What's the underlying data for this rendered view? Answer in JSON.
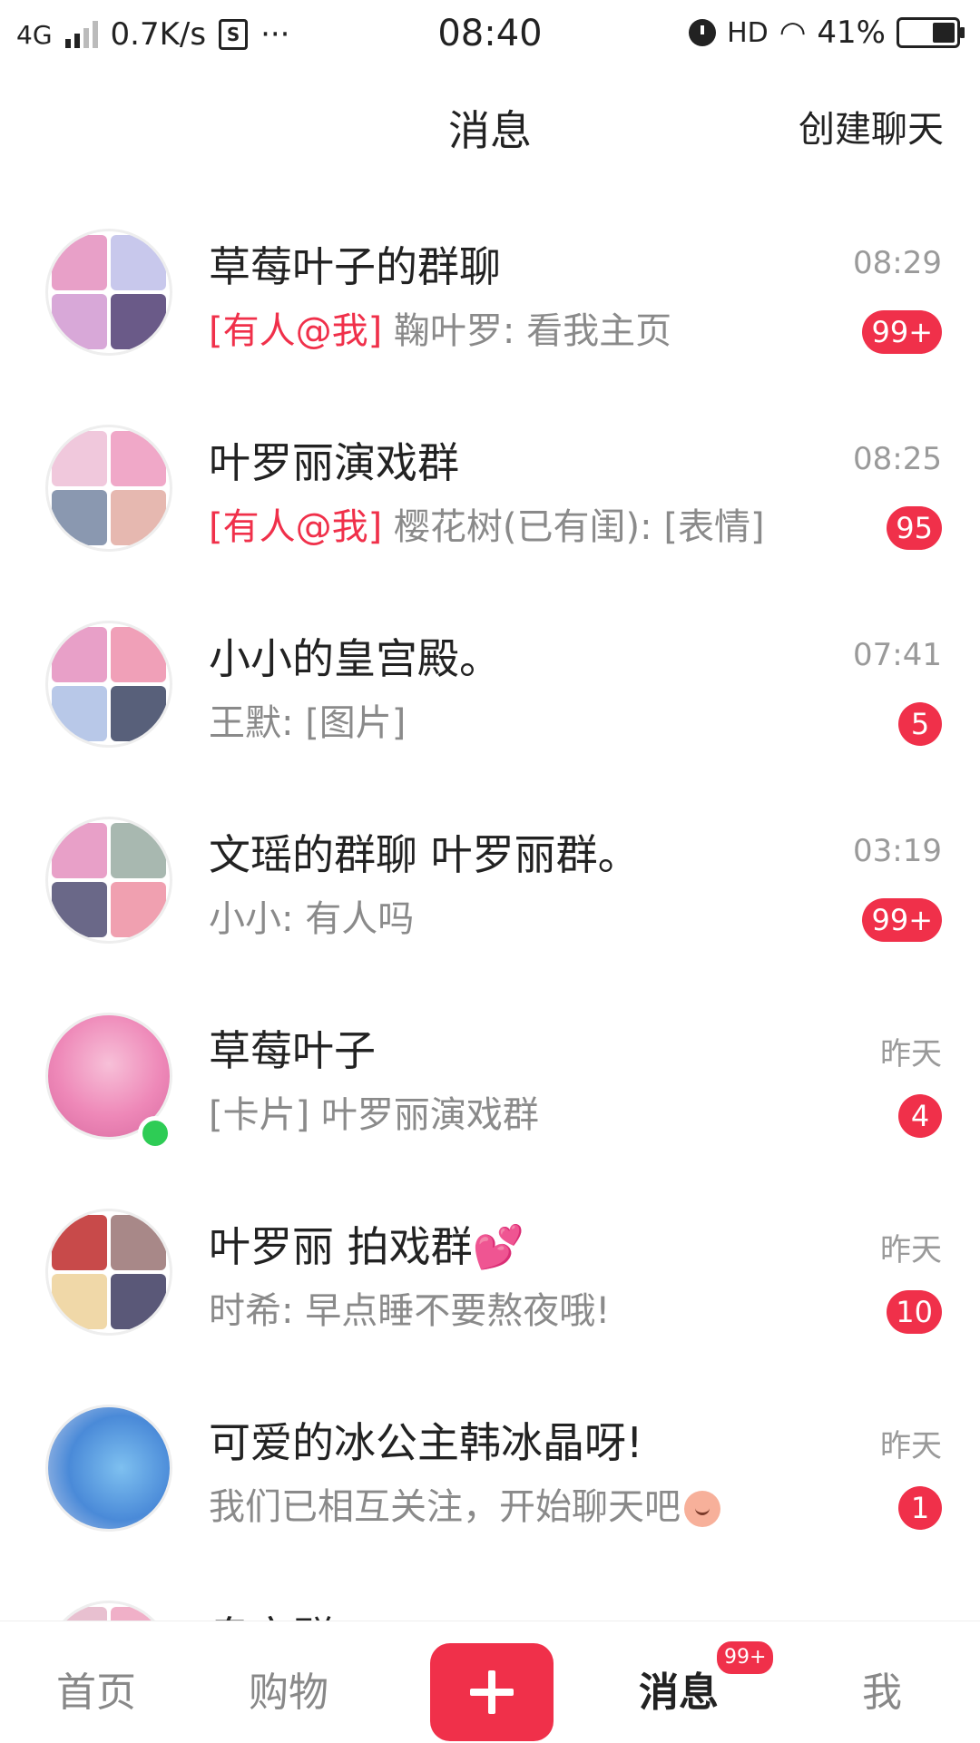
{
  "status_bar": {
    "network": "4G",
    "speed": "0.7K/s",
    "sim_icon": "S",
    "more": "···",
    "time": "08:40",
    "hd": "HD",
    "battery": "41%"
  },
  "header": {
    "title": "消息",
    "create_chat": "创建聊天"
  },
  "conversations": [
    {
      "name": "草莓叶子的群聊",
      "mention": "[有人@我]",
      "preview": " 鞠叶罗: 看我主页",
      "time": "08:29",
      "badge": "99+"
    },
    {
      "name": "叶罗丽演戏群",
      "mention": "[有人@我]",
      "preview": " 樱花树(已有闺): [表情]",
      "time": "08:25",
      "badge": "95"
    },
    {
      "name": "小小的皇宫殿。",
      "mention": "",
      "preview": "王默: [图片]",
      "time": "07:41",
      "badge": "5"
    },
    {
      "name": "文瑶的群聊 叶罗丽群。",
      "mention": "",
      "preview": "小小: 有人吗",
      "time": "03:19",
      "badge": "99+"
    },
    {
      "name": "草莓叶子",
      "mention": "",
      "preview": "[卡片] 叶罗丽演戏群",
      "time": "昨天",
      "badge": "4"
    },
    {
      "name": " 叶罗丽 拍戏群",
      "mention": "",
      "preview": "时希: 早点睡不要熬夜哦!",
      "time": "昨天",
      "badge": "10"
    },
    {
      "name": "可爱的冰公主韩冰晶呀!",
      "mention": "",
      "preview": "我们已相互关注，开始聊天吧",
      "time": "昨天",
      "badge": "1"
    }
  ],
  "partial_item_name": "皇宫群",
  "bottom_nav": {
    "home": "首页",
    "shop": "购物",
    "messages": "消息",
    "messages_badge": "99+",
    "me": "我"
  },
  "colors": {
    "accent": "#f0304a",
    "online": "#2ecc55",
    "muted_text": "#8a8a8a"
  }
}
